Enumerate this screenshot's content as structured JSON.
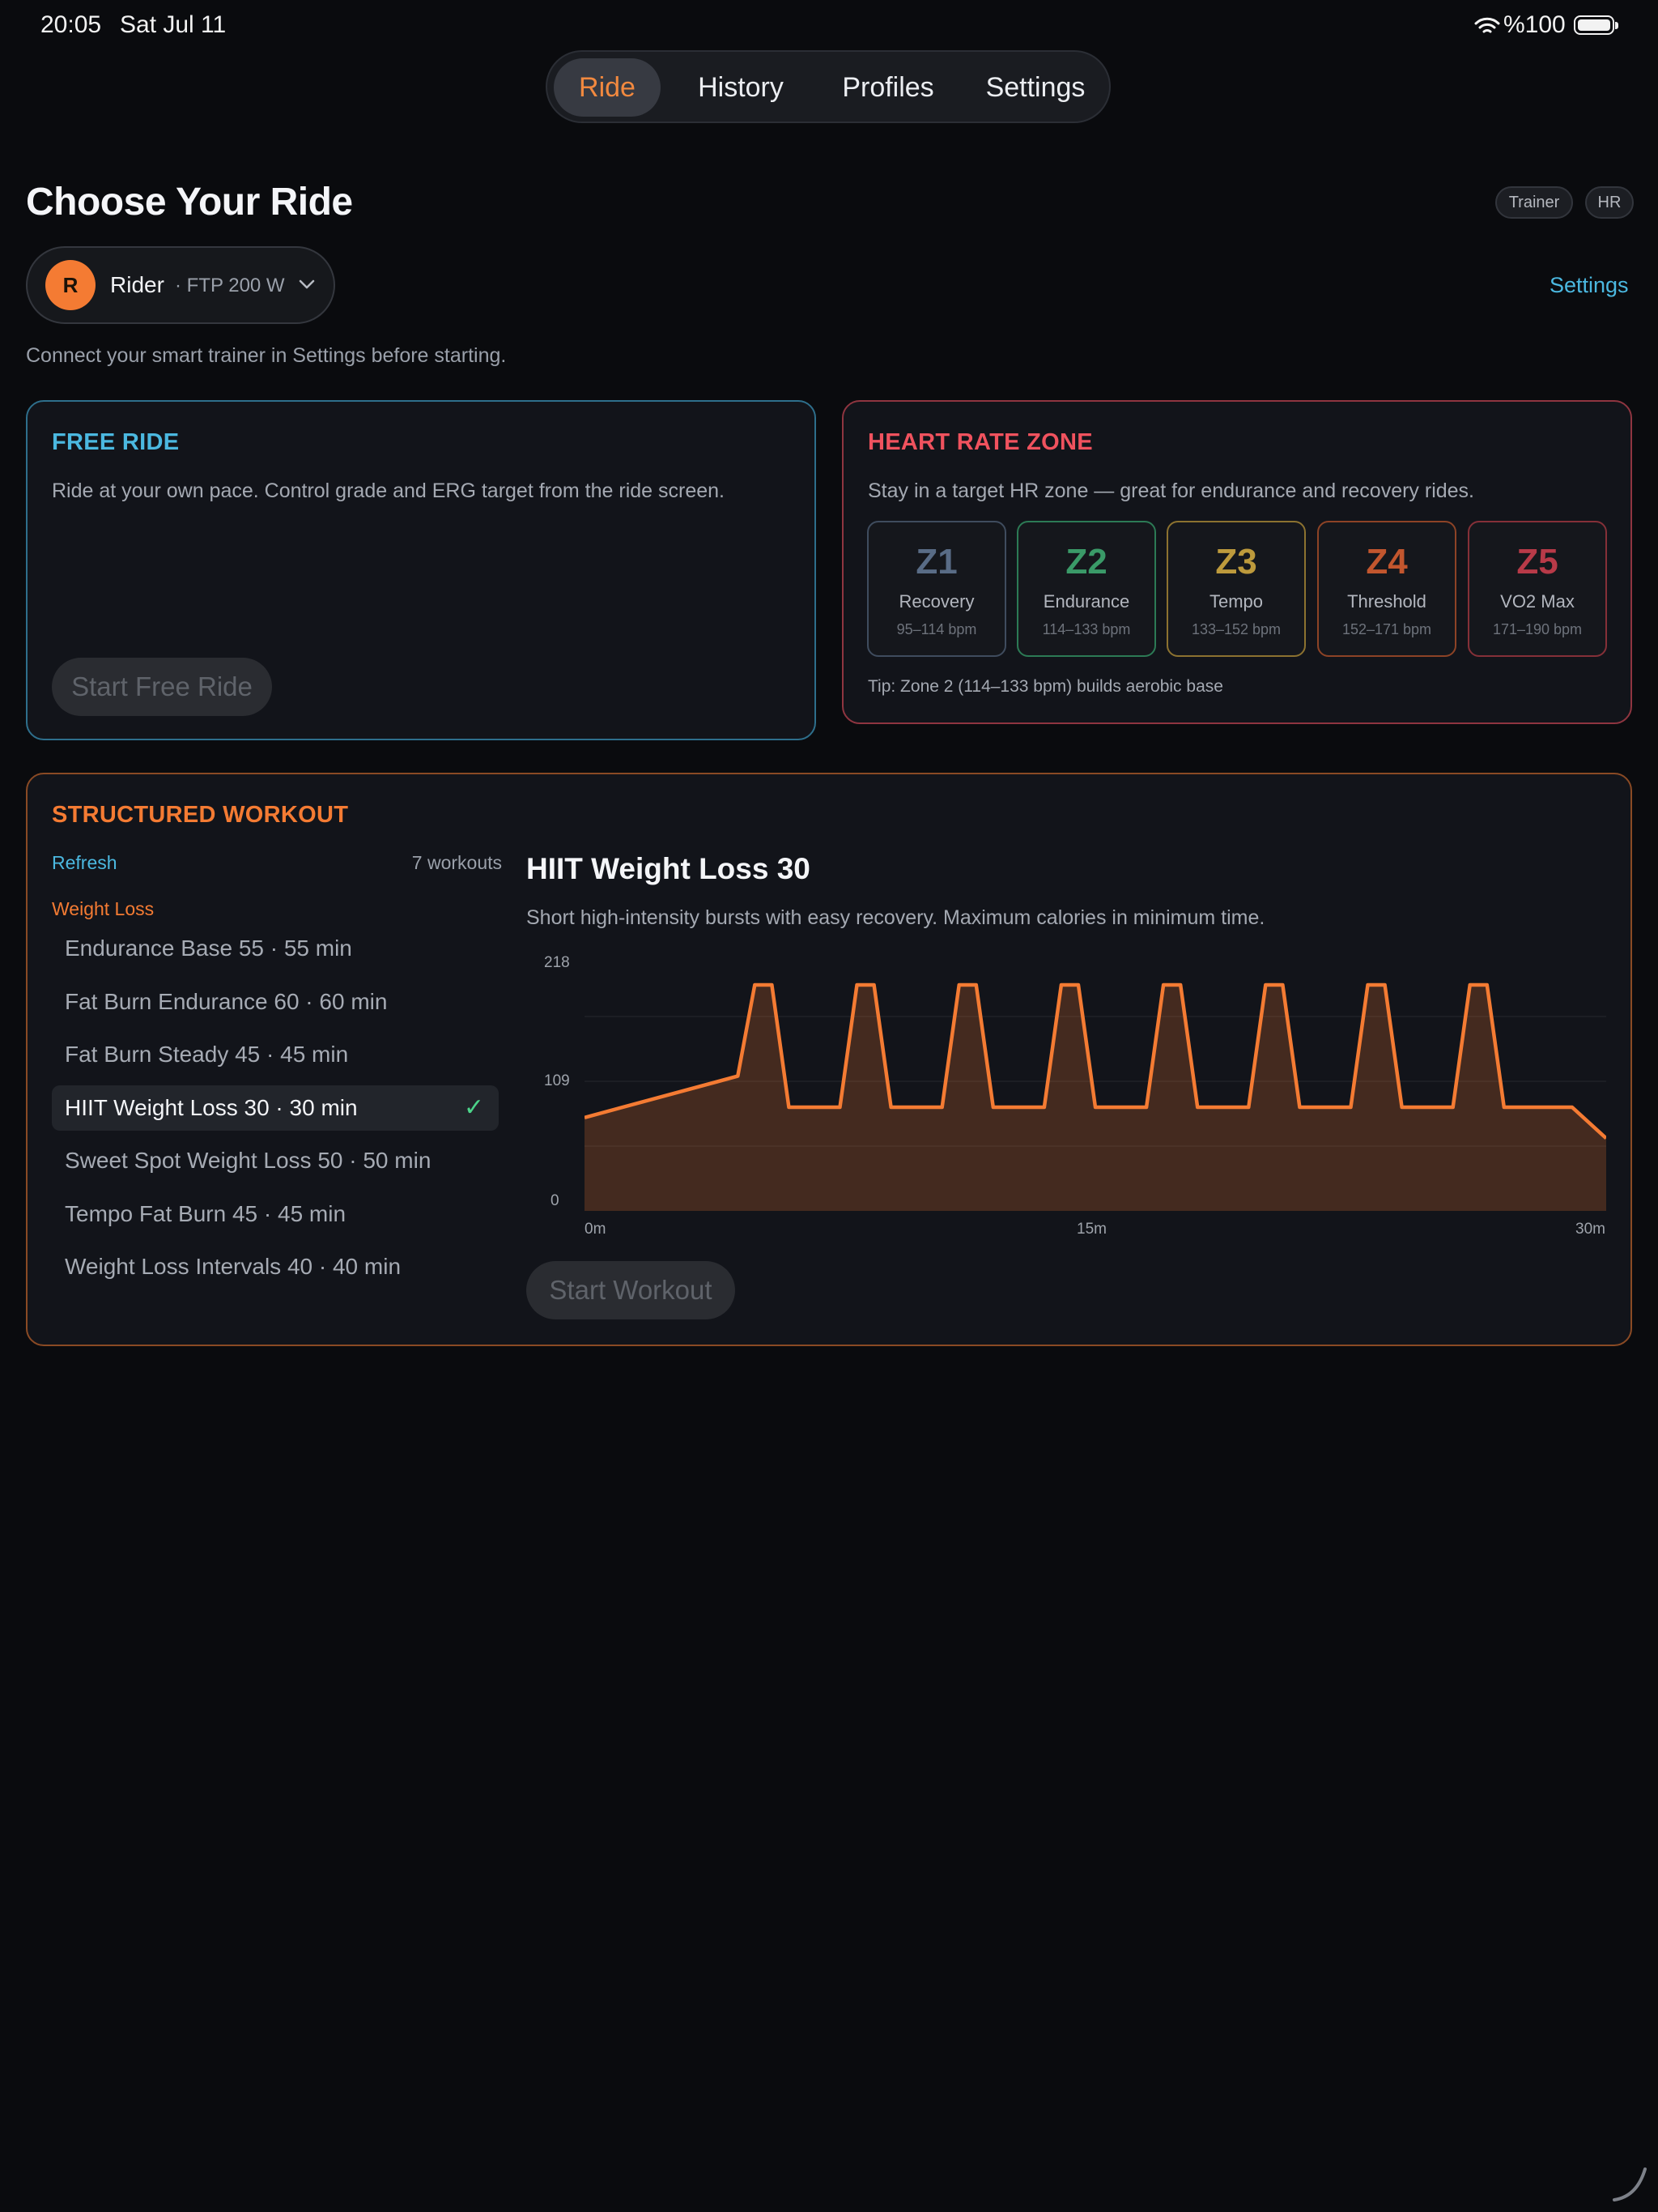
{
  "status_bar": {
    "time": "20:05",
    "date": "Sat Jul 11",
    "battery": "%100"
  },
  "tabs": [
    {
      "label": "Ride",
      "active": true
    },
    {
      "label": "History",
      "active": false
    },
    {
      "label": "Profiles",
      "active": false
    },
    {
      "label": "Settings",
      "active": false
    }
  ],
  "header": {
    "title": "Choose Your Ride",
    "chips": [
      "Trainer",
      "HR"
    ],
    "settings_link": "Settings",
    "notice": "Connect your smart trainer in Settings before starting."
  },
  "rider": {
    "initial": "R",
    "name": "Rider",
    "ftp": "· FTP 200 W"
  },
  "free_ride": {
    "title": "FREE RIDE",
    "description": "Ride at your own pace. Control grade and ERG target from the ride screen.",
    "button": "Start Free Ride",
    "accent": "#4bb8e0"
  },
  "hr_zone": {
    "title": "HEART RATE ZONE",
    "description": "Stay in a target HR zone — great for endurance and recovery rides.",
    "accent": "#f0525e",
    "zones": [
      {
        "label": "Z1",
        "name": "Recovery",
        "range": "95–114 bpm",
        "color": "#596c86"
      },
      {
        "label": "Z2",
        "name": "Endurance",
        "range": "114–133 bpm",
        "color": "#3a9a68"
      },
      {
        "label": "Z3",
        "name": "Tempo",
        "range": "133–152 bpm",
        "color": "#bd9a3c"
      },
      {
        "label": "Z4",
        "name": "Threshold",
        "range": "152–171 bpm",
        "color": "#c2562e"
      },
      {
        "label": "Z5",
        "name": "VO2 Max",
        "range": "171–190 bpm",
        "color": "#b83a48"
      }
    ],
    "tip": "Tip: Zone 2 (114–133 bpm) builds aerobic base"
  },
  "structured": {
    "title": "STRUCTURED WORKOUT",
    "accent": "#f47b33",
    "refresh": "Refresh",
    "count": "7 workouts",
    "category": "Weight Loss",
    "workouts": [
      {
        "label": "Endurance Base 55 · 55 min",
        "selected": false
      },
      {
        "label": "Fat Burn Endurance 60 · 60 min",
        "selected": false
      },
      {
        "label": "Fat Burn Steady 45 · 45 min",
        "selected": false
      },
      {
        "label": "HIIT Weight Loss 30 · 30 min",
        "selected": true
      },
      {
        "label": "Sweet Spot Weight Loss 50 · 50 min",
        "selected": false
      },
      {
        "label": "Tempo Fat Burn 45 · 45 min",
        "selected": false
      },
      {
        "label": "Weight Loss Intervals 40 · 40 min",
        "selected": false
      }
    ],
    "check_icon": "✓",
    "detail_title": "HIIT Weight Loss 30",
    "detail_description": "Short high-intensity bursts with easy recovery. Maximum calories in minimum time.",
    "button": "Start Workout"
  },
  "chart_data": {
    "type": "area",
    "y_ticks": [
      "218",
      "109",
      "0"
    ],
    "ylim": [
      0,
      218
    ],
    "x_ticks": [
      "0m",
      "15m",
      "30m"
    ],
    "xlim": [
      0,
      30
    ],
    "series": [
      {
        "x": [
          0,
          4.5,
          5.0,
          5.5,
          6.0,
          7.5,
          8.0,
          8.5,
          9.0,
          10.5,
          11.0,
          11.5,
          12.0,
          13.5,
          14.0,
          14.5,
          15.0,
          16.5,
          17.0,
          17.5,
          18.0,
          19.5,
          20.0,
          20.5,
          21.0,
          22.5,
          23.0,
          23.5,
          24.0,
          25.5,
          26.0,
          26.5,
          27.0,
          29.0,
          30.0
        ],
        "y": [
          90,
          130,
          218,
          218,
          100,
          100,
          218,
          218,
          100,
          100,
          218,
          218,
          100,
          100,
          218,
          218,
          100,
          100,
          218,
          218,
          100,
          100,
          218,
          218,
          100,
          100,
          218,
          218,
          100,
          100,
          218,
          218,
          100,
          100,
          70
        ]
      }
    ]
  }
}
